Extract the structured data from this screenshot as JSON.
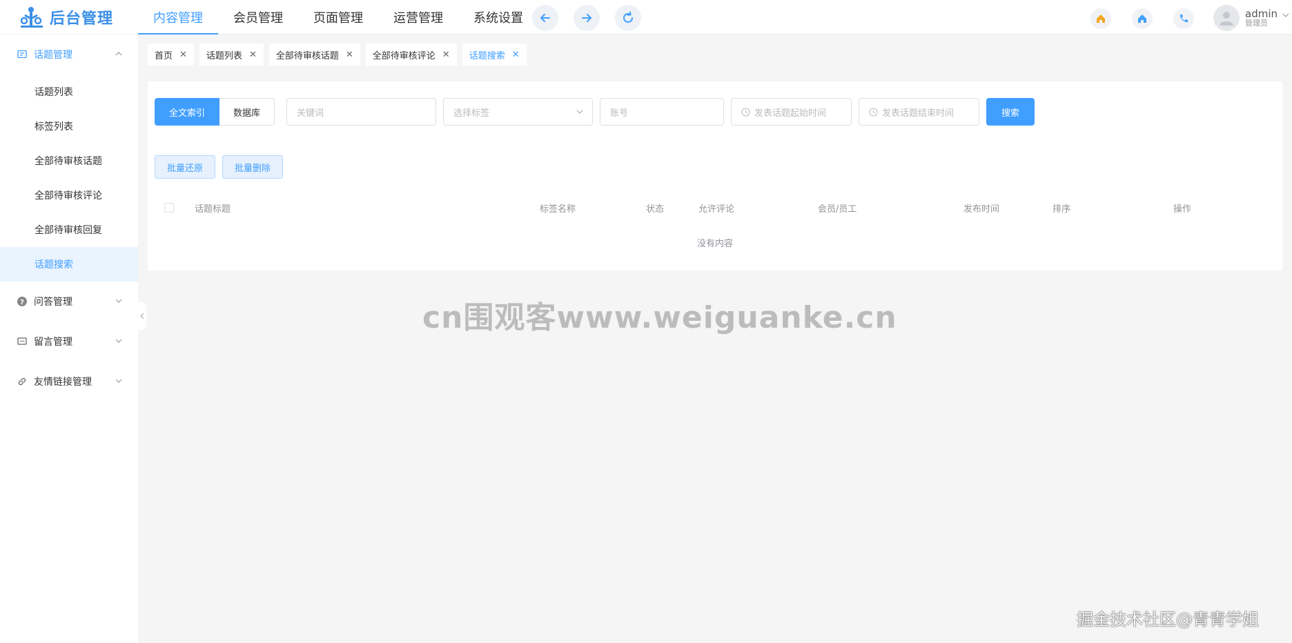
{
  "header": {
    "logo_text": "后台管理",
    "nav": [
      "内容管理",
      "会员管理",
      "页面管理",
      "运营管理",
      "系统设置"
    ],
    "active_nav": 0,
    "user": {
      "name": "admin",
      "role": "管理员"
    }
  },
  "sidebar": {
    "groups": [
      {
        "label": "话题管理",
        "icon": "message-icon",
        "expanded": true
      },
      {
        "label": "问答管理",
        "icon": "question-icon",
        "expanded": false
      },
      {
        "label": "留言管理",
        "icon": "comment-icon",
        "expanded": false
      },
      {
        "label": "友情链接管理",
        "icon": "link-icon",
        "expanded": false
      }
    ],
    "sub_items": [
      "话题列表",
      "标签列表",
      "全部待审核话题",
      "全部待审核评论",
      "全部待审核回复",
      "话题搜索"
    ],
    "active_sub": 5
  },
  "tabs": [
    {
      "label": "首页"
    },
    {
      "label": "话题列表"
    },
    {
      "label": "全部待审核话题"
    },
    {
      "label": "全部待审核评论"
    },
    {
      "label": "话题搜索",
      "active": true
    }
  ],
  "search": {
    "mode_fulltext": "全文索引",
    "mode_database": "数据库",
    "keyword_placeholder": "关键词",
    "tag_placeholder": "选择标签",
    "account_placeholder": "账号",
    "start_placeholder": "发表话题起始时间",
    "end_placeholder": "发表话题结束时间",
    "search_label": "搜索"
  },
  "actions": {
    "restore_label": "批量还原",
    "delete_label": "批量删除"
  },
  "table": {
    "columns": [
      "话题标题",
      "标签名称",
      "状态",
      "允许评论",
      "会员/员工",
      "发布时间",
      "排序",
      "操作"
    ],
    "empty_text": "没有内容"
  },
  "watermarks": {
    "center": "cn围观客www.weiguanke.cn",
    "corner": "掘金技术社区@青青学姐"
  },
  "colors": {
    "accent": "#409eff",
    "logo": "#3b8fe8",
    "home_icon": "#f5a623"
  }
}
